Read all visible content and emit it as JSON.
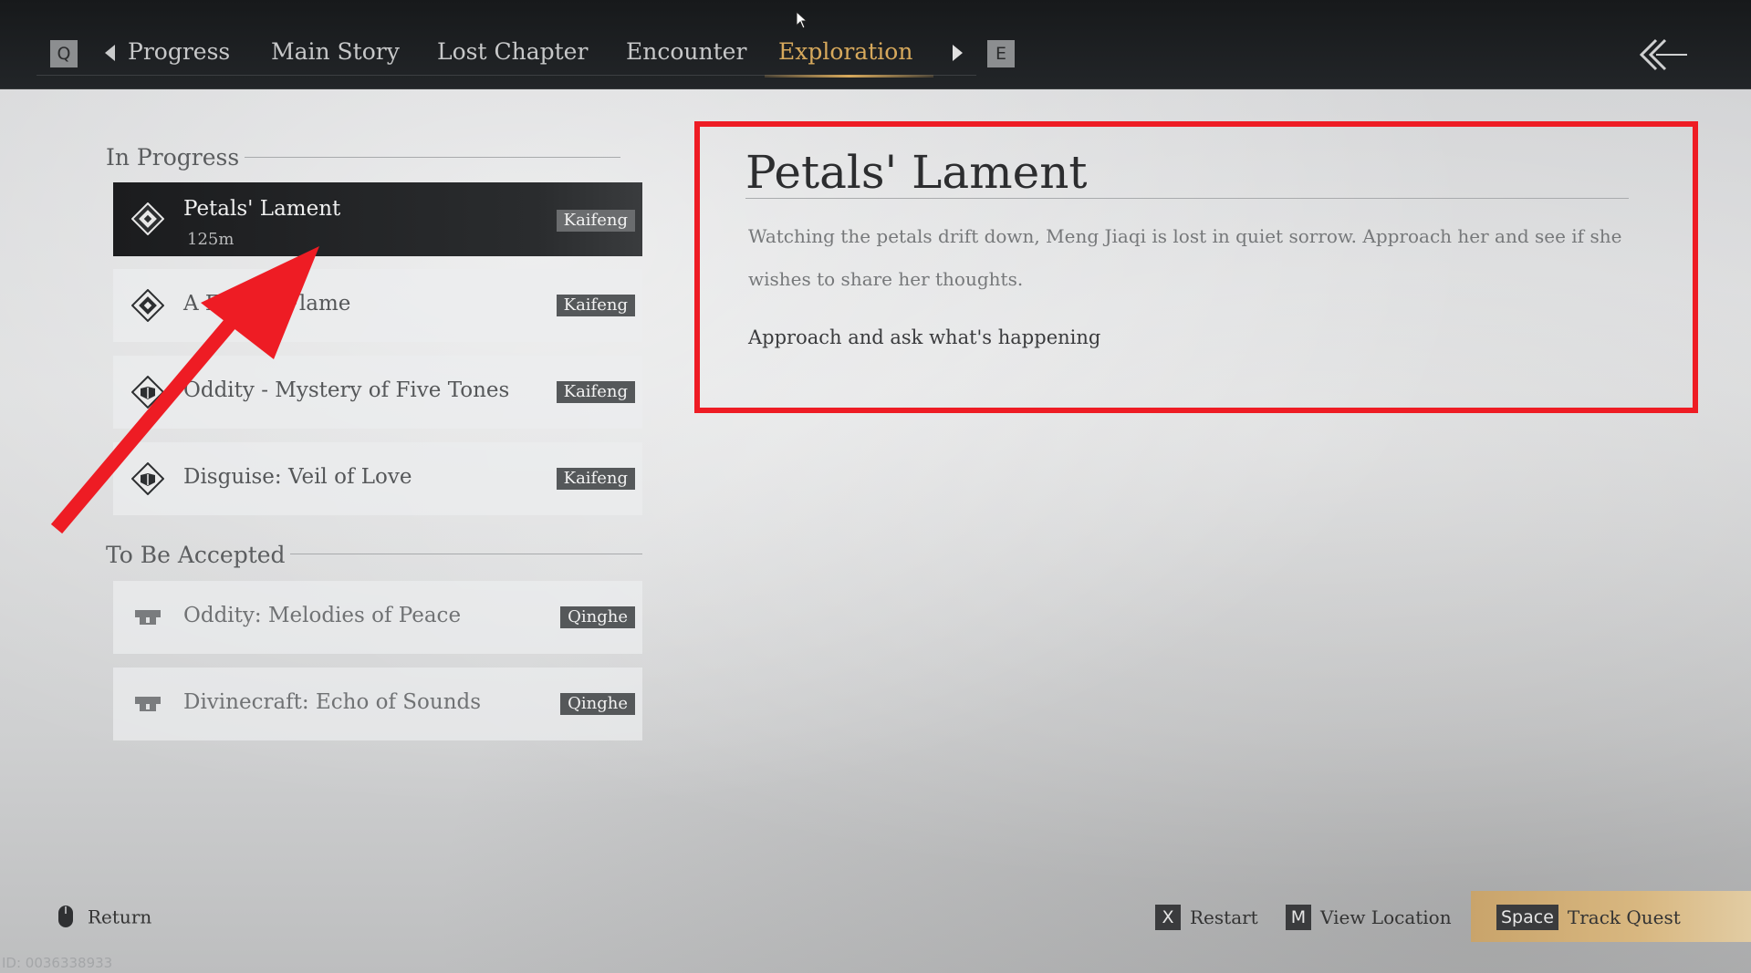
{
  "nav": {
    "key_left": "Q",
    "key_right": "E",
    "tabs": [
      {
        "label": "Progress",
        "active": false
      },
      {
        "label": "Main Story",
        "active": false
      },
      {
        "label": "Lost Chapter",
        "active": false
      },
      {
        "label": "Encounter",
        "active": false
      },
      {
        "label": "Exploration",
        "active": true
      }
    ],
    "active_color": "#d7a95c",
    "back_icon": "double-chevron-left-icon"
  },
  "in_progress": {
    "header": "In Progress",
    "quests": [
      {
        "title": "Petals' Lament",
        "distance": "125m",
        "location": "Kaifeng",
        "icon": "exploration-diamond-icon",
        "selected": true
      },
      {
        "title": "A Fading Flame",
        "location": "Kaifeng",
        "icon": "exploration-diamond-icon"
      },
      {
        "title": "Oddity - Mystery of Five Tones",
        "location": "Kaifeng",
        "icon": "oddity-diamond-icon"
      },
      {
        "title": "Disguise: Veil of Love",
        "location": "Kaifeng",
        "icon": "oddity-diamond-icon"
      }
    ]
  },
  "to_be_accepted": {
    "header": "To Be Accepted",
    "quests": [
      {
        "title": "Oddity: Melodies of Peace",
        "location": "Qinghe",
        "icon": "scroll-icon"
      },
      {
        "title": "Divinecraft: Echo of Sounds",
        "location": "Qinghe",
        "icon": "scroll-icon"
      }
    ]
  },
  "detail": {
    "title": "Petals' Lament",
    "description": "Watching the petals drift down, Meng Jiaqi is lost in quiet sorrow. Approach her and see if she wishes to share her thoughts.",
    "objective": "Approach and ask what's happening",
    "highlight_color": "#ee1c24"
  },
  "footer": {
    "return_label": "Return",
    "restart_key": "X",
    "restart_label": "Restart",
    "view_key": "M",
    "view_label": "View Location",
    "track_key": "Space",
    "track_label": "Track Quest",
    "track_color": "#d8b780"
  },
  "watermark": "ID: 0036338933"
}
